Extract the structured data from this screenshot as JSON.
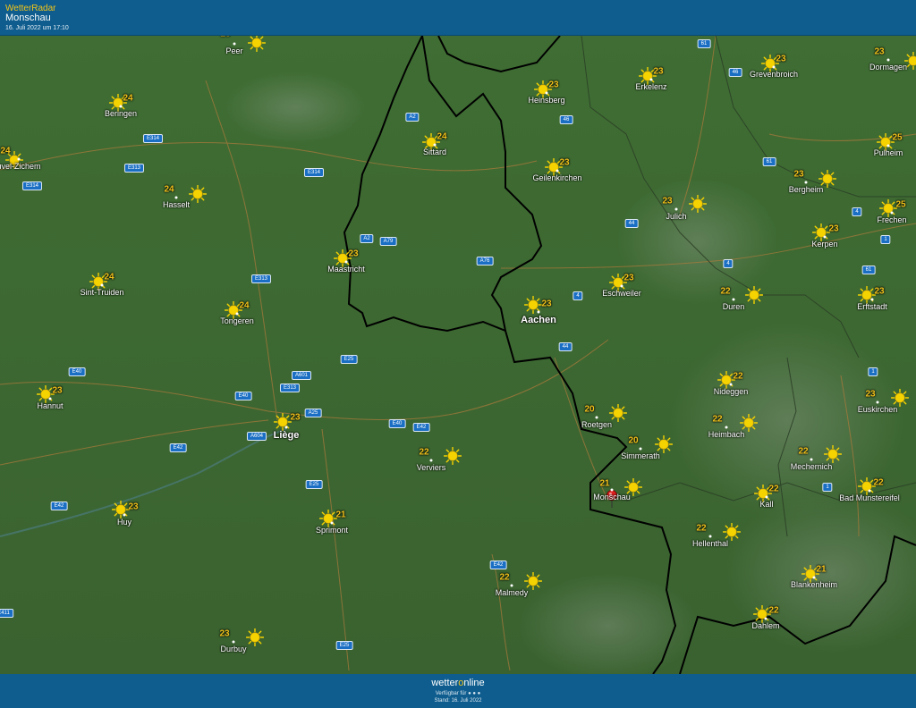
{
  "header": {
    "app_title": "WetterRadar",
    "place": "Monschau",
    "timestamp": "16. Juli 2022 um 17:10"
  },
  "footer": {
    "brand_left": "wetter",
    "brand_o": "o",
    "brand_right": "nline",
    "available": "Verfügbar für ● ● ●",
    "stand": "Stand: 16. Juli 2022"
  },
  "colors": {
    "header_bg": "#0e5d8e",
    "temp_text": "#f2c21a",
    "sun": "#f5d300",
    "road_badge": "#1a6fc4",
    "pin": "#e02020"
  },
  "icons": {
    "weather": "sun-icon",
    "marker": "location-pin-icon"
  },
  "cities": [
    {
      "name": "Peer",
      "temp": "23"
    },
    {
      "name": "Beringen",
      "temp": "24"
    },
    {
      "name": "Heinsberg",
      "temp": "23"
    },
    {
      "name": "Erkelenz",
      "temp": "23"
    },
    {
      "name": "Grevenbroich",
      "temp": "23"
    },
    {
      "name": "Dormagen",
      "temp": "23"
    },
    {
      "name": "Sittard",
      "temp": "24"
    },
    {
      "name": "Pulheim",
      "temp": "25"
    },
    {
      "name": "uvel-Zichem",
      "temp": "24"
    },
    {
      "name": "Geilenkirchen",
      "temp": "23"
    },
    {
      "name": "Hasselt",
      "temp": "24"
    },
    {
      "name": "Bergheim",
      "temp": "23"
    },
    {
      "name": "Julich",
      "temp": "23"
    },
    {
      "name": "Frechen",
      "temp": "25"
    },
    {
      "name": "Kerpen",
      "temp": "23"
    },
    {
      "name": "Maastricht",
      "temp": "23"
    },
    {
      "name": "Sint-Truiden",
      "temp": "24"
    },
    {
      "name": "Eschweiler",
      "temp": "23"
    },
    {
      "name": "Duren",
      "temp": "22"
    },
    {
      "name": "Erftstadt",
      "temp": "23"
    },
    {
      "name": "Tongeren",
      "temp": "24"
    },
    {
      "name": "Aachen",
      "temp": "23"
    },
    {
      "name": "Nideggen",
      "temp": "22"
    },
    {
      "name": "Hannut",
      "temp": "23"
    },
    {
      "name": "Euskirchen",
      "temp": "23"
    },
    {
      "name": "Roetgen",
      "temp": "20"
    },
    {
      "name": "Heimbach",
      "temp": "22"
    },
    {
      "name": "Liège",
      "temp": "23"
    },
    {
      "name": "Simmerath",
      "temp": "20"
    },
    {
      "name": "Verviers",
      "temp": "22"
    },
    {
      "name": "Mechernich",
      "temp": "22"
    },
    {
      "name": "Monschau",
      "temp": "21"
    },
    {
      "name": "Bad Munstereifel",
      "temp": "22"
    },
    {
      "name": "Kall",
      "temp": "22"
    },
    {
      "name": "Huy",
      "temp": "23"
    },
    {
      "name": "Sprimont",
      "temp": "21"
    },
    {
      "name": "Hellenthal",
      "temp": "22"
    },
    {
      "name": "Malmedy",
      "temp": "22"
    },
    {
      "name": "Blankenheim",
      "temp": "21"
    },
    {
      "name": "Dahlem",
      "temp": "22"
    },
    {
      "name": "Durbuy",
      "temp": "23"
    }
  ],
  "roads": [
    "61",
    "46",
    "46",
    "A2",
    "E314",
    "E313",
    "E314",
    "E314",
    "61",
    "44",
    "4",
    "A2",
    "A79",
    "A76",
    "1",
    "4",
    "61",
    "E313",
    "4",
    "44",
    "A601",
    "E25",
    "E40",
    "E313",
    "1",
    "E40",
    "A25",
    "E40",
    "E42",
    "A604",
    "E42",
    "E25",
    "1",
    "E42",
    "E42",
    "E25",
    "E411"
  ]
}
